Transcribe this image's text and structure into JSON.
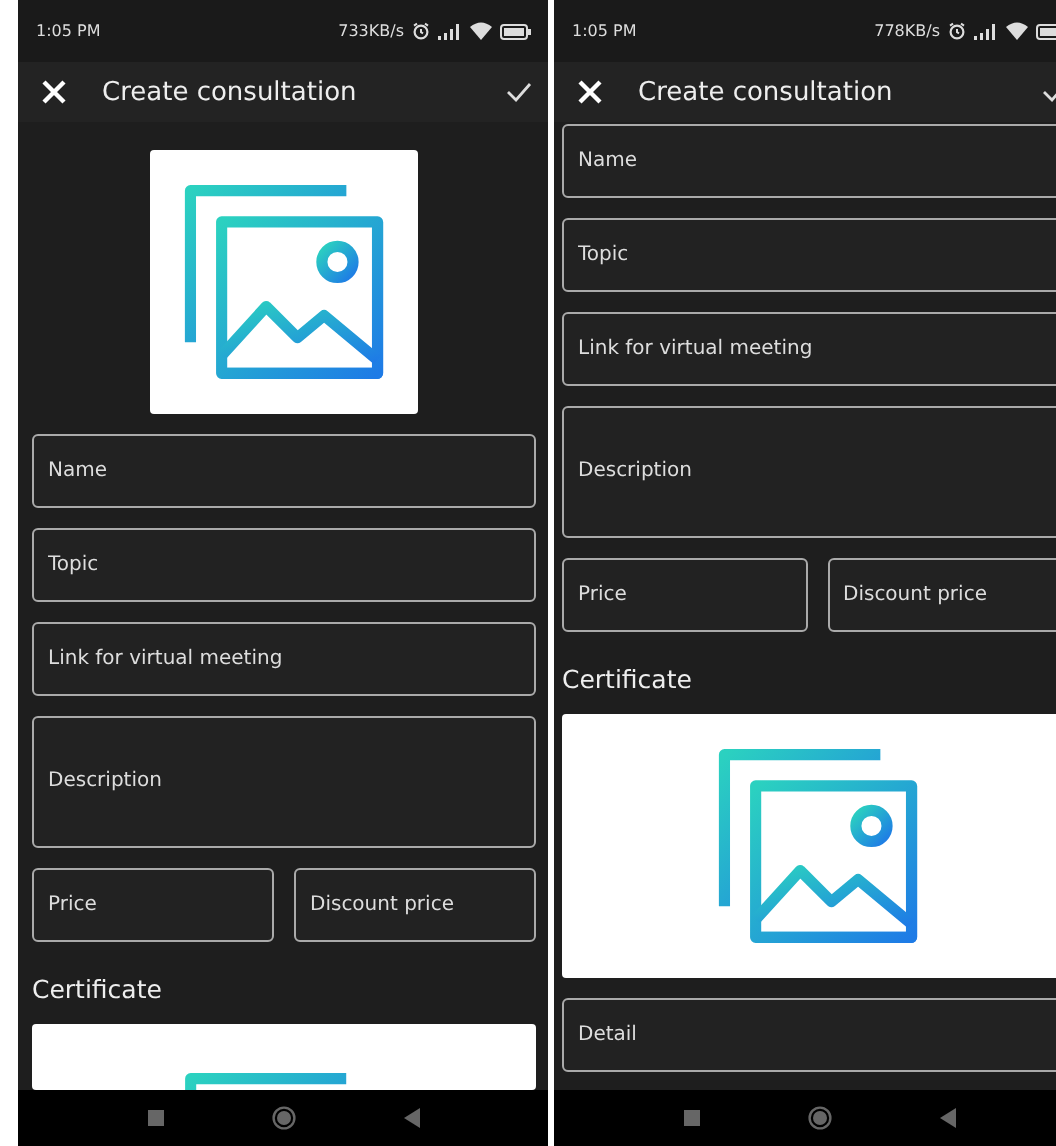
{
  "screens": [
    {
      "status_bar": {
        "time": "1:05 PM",
        "speed": "733KB/s"
      },
      "title": "Create consultation",
      "content": [
        {
          "kind": "image"
        },
        {
          "kind": "field",
          "placeholder": "Name"
        },
        {
          "kind": "field",
          "placeholder": "Topic"
        },
        {
          "kind": "field",
          "placeholder": "Link for virtual meeting"
        },
        {
          "kind": "textarea",
          "placeholder": "Description"
        },
        {
          "kind": "pair",
          "fields": [
            {
              "placeholder": "Price"
            },
            {
              "placeholder": "Discount price"
            }
          ]
        },
        {
          "kind": "heading",
          "text": "Certificate"
        },
        {
          "kind": "image"
        }
      ]
    },
    {
      "status_bar": {
        "time": "1:05 PM",
        "speed": "778KB/s"
      },
      "title": "Create consultation",
      "content": [
        {
          "kind": "field",
          "placeholder": "Name"
        },
        {
          "kind": "field",
          "placeholder": "Topic"
        },
        {
          "kind": "field",
          "placeholder": "Link for virtual meeting"
        },
        {
          "kind": "textarea",
          "placeholder": "Description"
        },
        {
          "kind": "pair",
          "fields": [
            {
              "placeholder": "Price"
            },
            {
              "placeholder": "Discount price"
            }
          ]
        },
        {
          "kind": "heading",
          "text": "Certificate"
        },
        {
          "kind": "image"
        },
        {
          "kind": "field",
          "placeholder": "Detail"
        }
      ]
    }
  ]
}
